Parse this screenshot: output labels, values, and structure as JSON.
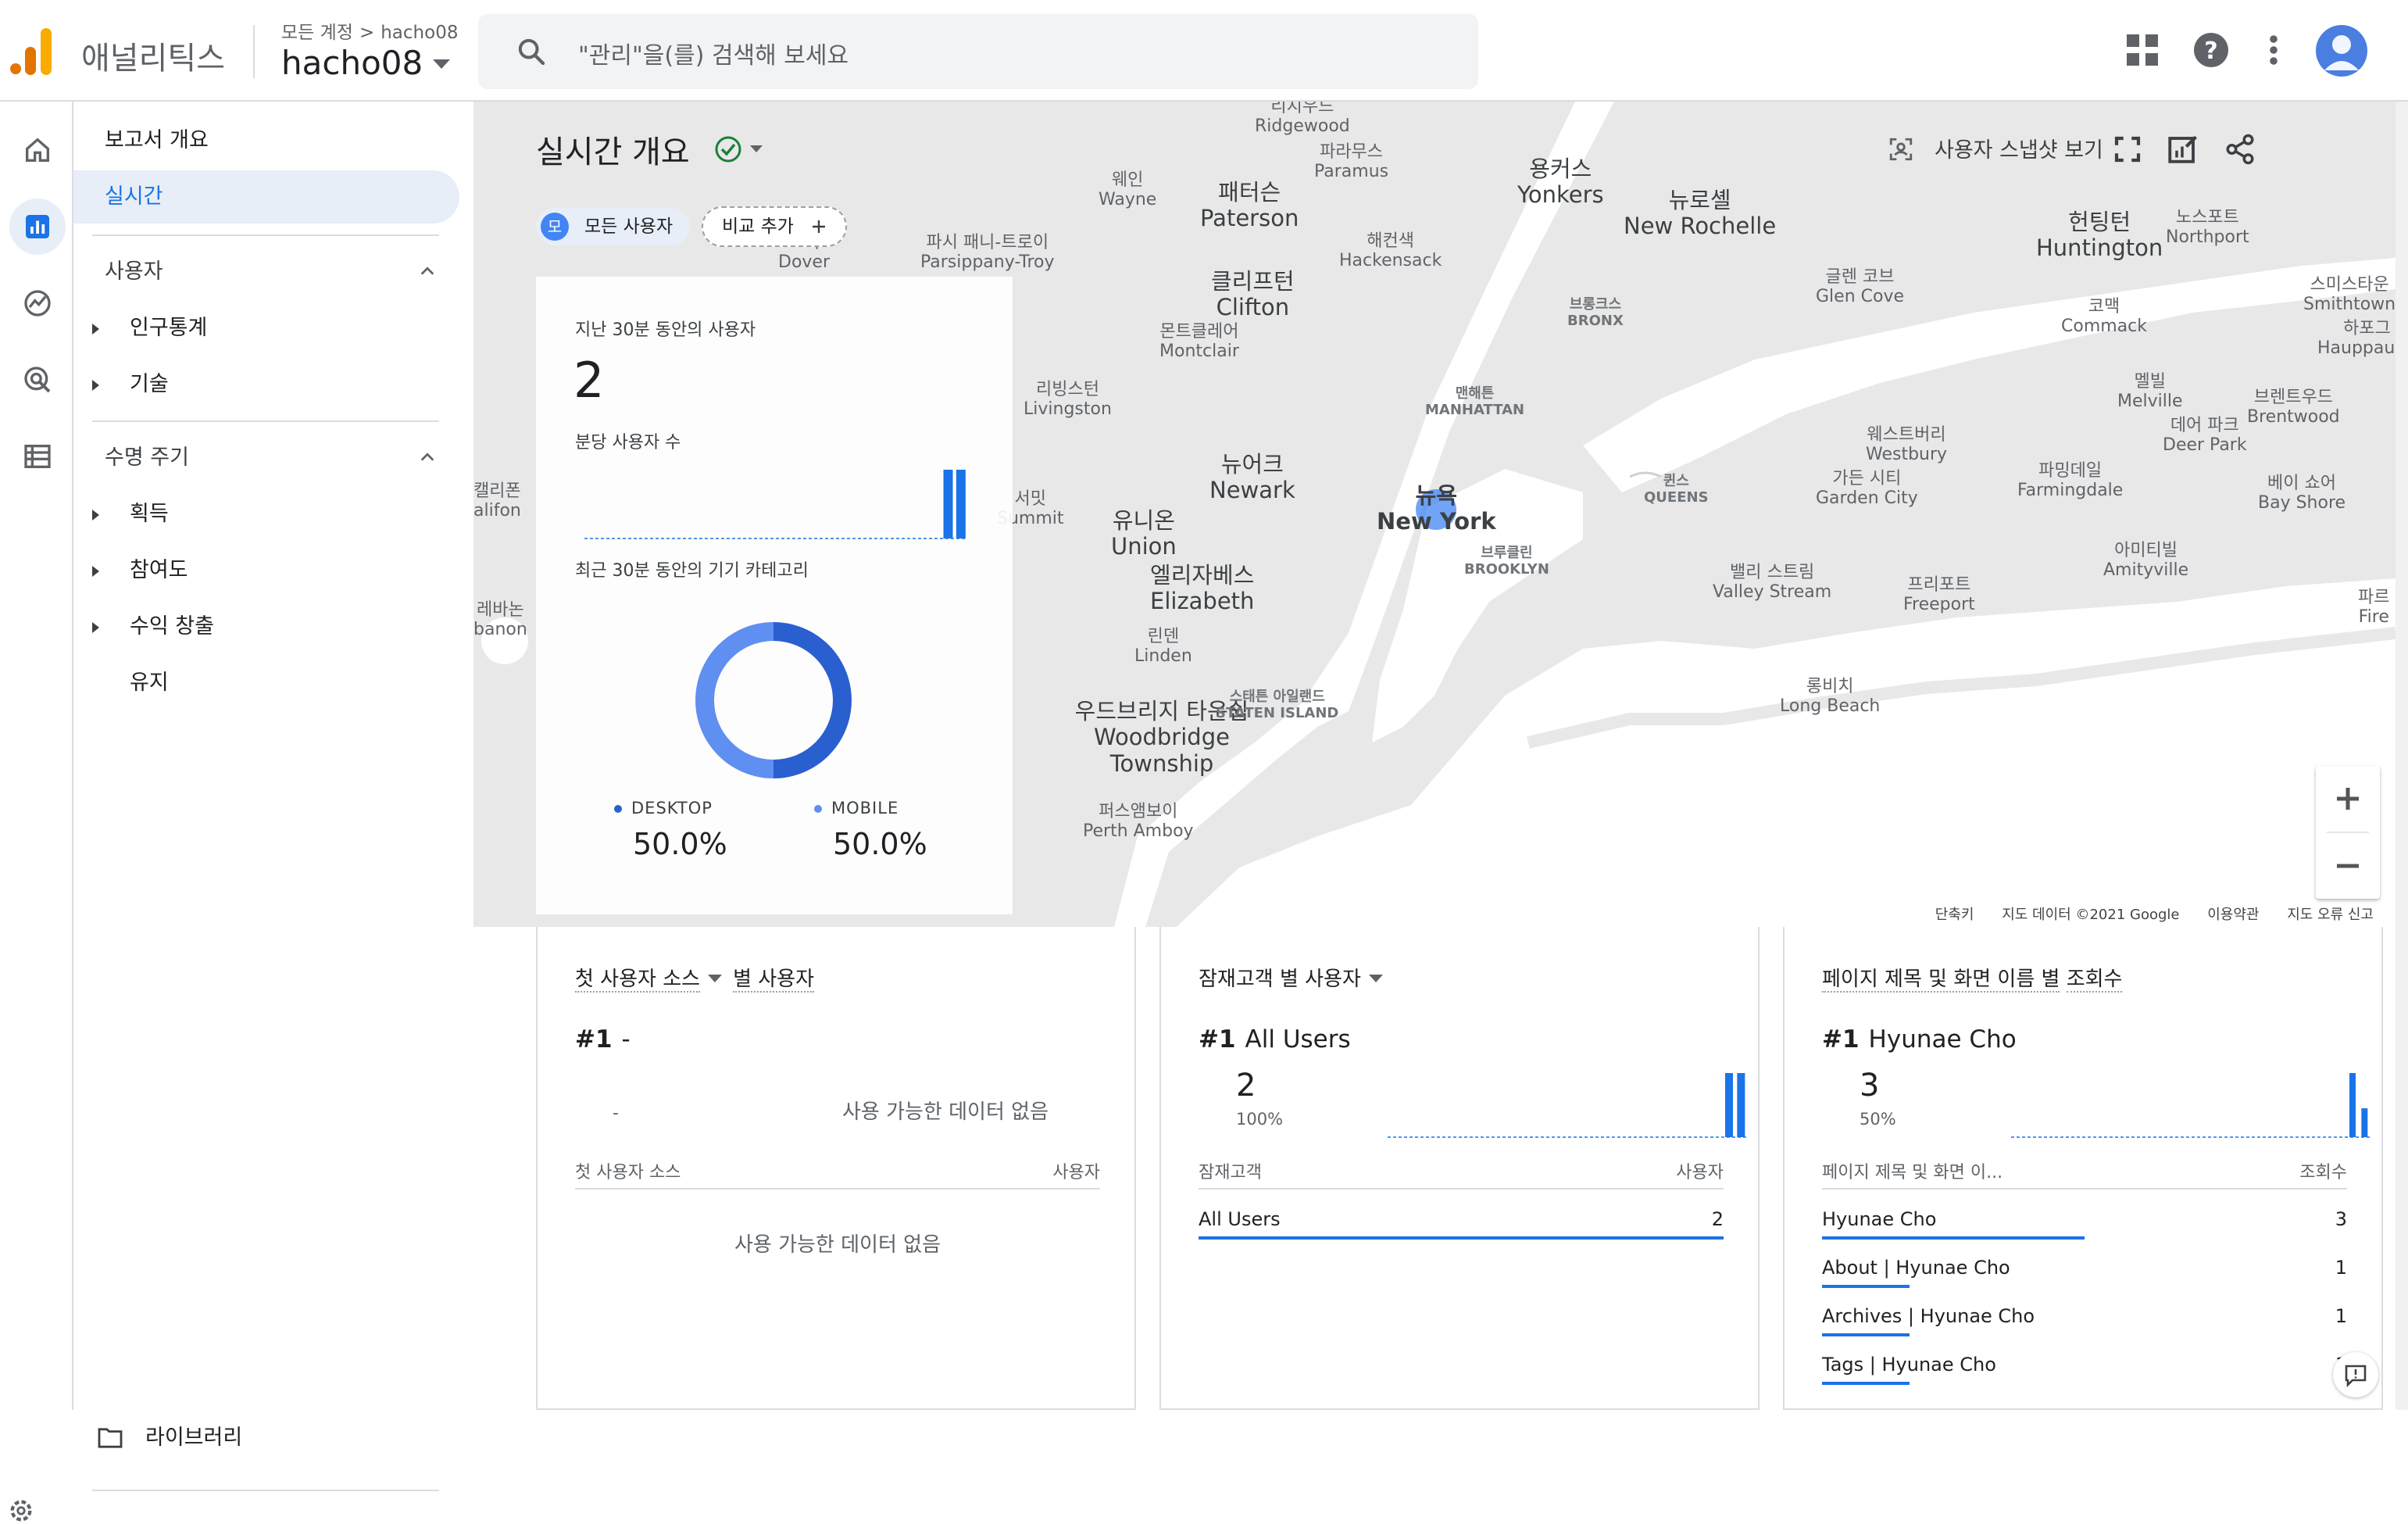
{
  "app": {
    "product_name": "애널리틱스"
  },
  "header": {
    "breadcrumb": {
      "root": "모든 계정",
      "sep": ">",
      "account": "hacho08"
    },
    "property": "hacho08",
    "search_placeholder": "\"관리\"을(를) 검색해 보세요"
  },
  "nav": {
    "overview": "보고서 개요",
    "realtime": "실시간",
    "users_section": "사용자",
    "users_items": [
      "인구통계",
      "기술"
    ],
    "lifecycle_section": "수명 주기",
    "lifecycle_items": [
      "획득",
      "참여도",
      "수익 창출",
      "유지"
    ],
    "library": "라이브러리"
  },
  "realtime": {
    "title": "실시간 개요",
    "snapshot": "사용자 스냅샷 보기",
    "chip_all": "모든 사용자",
    "chip_letter": "모",
    "chip_compare": "비교 추가"
  },
  "overview_card": {
    "users_label": "지난 30분 동안의 사용자",
    "users_value": "2",
    "per_minute_label": "분당 사용자 수",
    "per_minute": [
      0,
      0,
      0,
      0,
      0,
      0,
      0,
      0,
      0,
      0,
      0,
      0,
      0,
      0,
      0,
      0,
      0,
      0,
      0,
      0,
      0,
      0,
      0,
      0,
      0,
      0,
      0,
      0,
      1,
      1
    ],
    "device_label": "최근 30분 동안의 기기 카테고리",
    "devices": [
      {
        "name": "DESKTOP",
        "value": "50.0%",
        "share": 0.5,
        "color": "#2a5fcf"
      },
      {
        "name": "MOBILE",
        "value": "50.0%",
        "share": 0.5,
        "color": "#5f8ff0"
      }
    ]
  },
  "map": {
    "footer": [
      "단축키",
      "지도 데이터 ©2021 Google",
      "이용약관",
      "지도 오류 신고"
    ],
    "labels": [
      [
        "리지우드",
        "Ridgewood"
      ],
      [
        "파라무스",
        "Paramus"
      ],
      [
        "용커스",
        "Yonkers"
      ],
      [
        "뉴로셸",
        "New Rochelle"
      ],
      [
        "노스포트",
        "Northport"
      ],
      [
        "웨인",
        "Wayne"
      ],
      [
        "패터슨",
        "Paterson"
      ],
      [
        "해컨색",
        "Hackensack"
      ],
      [
        "헌팅턴",
        "Huntington"
      ],
      [
        "스미스타운",
        "Smithtown"
      ],
      [
        "클리프턴",
        "Clifton"
      ],
      [
        "글렌 코브",
        "Glen Cove"
      ],
      [
        "코맥",
        "Commack"
      ],
      [
        "하포그",
        "Hauppauge"
      ],
      [
        "몬트클레어",
        "Montclair"
      ],
      [
        "리빙스턴",
        "Livingston"
      ],
      [
        "멜빌",
        "Melville"
      ],
      [
        "브렌트우드",
        "Brentwood"
      ],
      [
        "데어 파크",
        "Deer Park"
      ],
      [
        "웨스트버리",
        "Westbury"
      ],
      [
        "뉴어크",
        "Newark"
      ],
      [
        "유니온",
        "Union"
      ],
      [
        "파밍데일",
        "Farmingdale"
      ],
      [
        "가든 시티",
        "Garden City"
      ],
      [
        "베이 쇼어",
        "Bay Shore"
      ],
      [
        "엘리자베스",
        "Elizabeth"
      ],
      [
        "밸리 스트림",
        "Valley Stream"
      ],
      [
        "아미티빌",
        "Amityville"
      ],
      [
        "프리포트",
        "Freeport"
      ],
      [
        "린덴",
        "Linden"
      ],
      [
        "롱비치",
        "Long Beach"
      ],
      [
        "우드브리지 타운쉽",
        "Woodbridge Township"
      ],
      [
        "퍼스앰보이",
        "Perth Amboy"
      ],
      [
        "뉴욕",
        "New York"
      ],
      [
        "맨해튼",
        "MANHATTAN"
      ],
      [
        "브롱크스",
        "BRONX"
      ],
      [
        "퀸스",
        "QUEENS"
      ],
      [
        "브루클린",
        "BROOKLYN"
      ],
      [
        "스태튼 아일랜드",
        "STATEN ISLAND"
      ],
      [
        "파시 패니-트로이",
        "Parsippany-Troy"
      ],
      [
        "도버",
        "Dover"
      ],
      [
        "서밋",
        "Summit"
      ],
      [
        "캘리폰",
        "alifon"
      ],
      [
        "레바논",
        "banon"
      ],
      [
        "파르",
        "Fire"
      ]
    ]
  },
  "cards": [
    {
      "title_prefix": "첫 사용자 소스",
      "title_suffix": "별 사용자",
      "rank": "#1",
      "top_name": "-",
      "dash": "-",
      "nodata": "사용 가능한 데이터 없음",
      "col_left": "첫 사용자 소스",
      "col_right": "사용자",
      "table_nodata": "사용 가능한 데이터 없음"
    },
    {
      "title_prefix": "잠재고객 별 사용자",
      "rank": "#1",
      "top_name": "All Users",
      "big": "2",
      "pct": "100%",
      "col_left": "잠재고객",
      "col_right": "사용자",
      "rows": [
        {
          "label": "All Users",
          "value": "2",
          "share": 1.0
        }
      ],
      "spark": [
        0,
        0,
        0,
        0,
        0,
        0,
        0,
        0,
        0,
        0,
        0,
        0,
        0,
        0,
        0,
        0,
        0,
        0,
        0,
        0,
        0,
        0,
        0,
        0,
        0,
        0,
        0,
        0,
        1,
        1
      ]
    },
    {
      "title_prefix": "페이지 제목 및 화면 이름 별",
      "title_suffix": "조회수",
      "rank": "#1",
      "top_name": "Hyunae Cho",
      "big": "3",
      "pct": "50%",
      "col_left": "페이지 제목 및 화면 이...",
      "col_right": "조회수",
      "rows": [
        {
          "label": "Hyunae Cho",
          "value": "3",
          "share": 0.5
        },
        {
          "label": "About | Hyunae Cho",
          "value": "1",
          "share": 0.167
        },
        {
          "label": "Archives | Hyunae Cho",
          "value": "1",
          "share": 0.167
        },
        {
          "label": "Tags | Hyunae Cho",
          "value": "1",
          "share": 0.167
        }
      ],
      "spark": [
        0,
        0,
        0,
        0,
        0,
        0,
        0,
        0,
        0,
        0,
        0,
        0,
        0,
        0,
        0,
        0,
        0,
        0,
        0,
        0,
        0,
        0,
        0,
        0,
        0,
        0,
        0,
        0,
        1,
        0.45
      ]
    }
  ],
  "colors": {
    "accent": "#1a73e8",
    "selected_bg": "#e8eef7",
    "map_land": "#e8e8e8",
    "map_water": "#ffffff"
  }
}
